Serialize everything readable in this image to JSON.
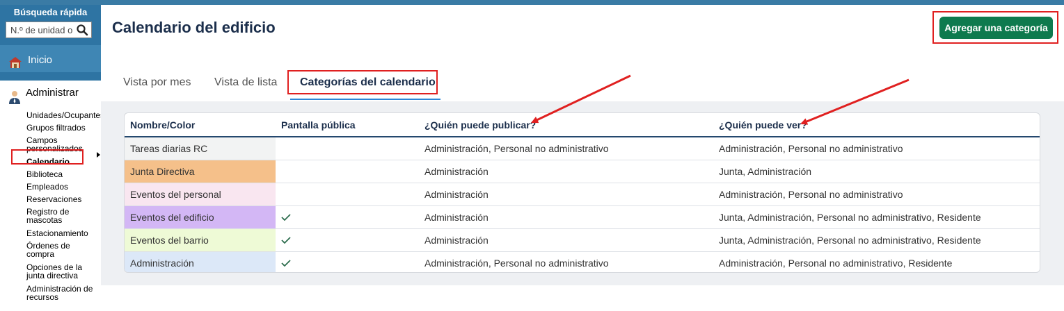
{
  "sidebar": {
    "quick_search": {
      "title": "Búsqueda rápida",
      "placeholder": "N.º de unidad o"
    },
    "home_label": "Inicio",
    "admin_label": "Administrar",
    "admin_items": [
      "Unidades/Ocupantes",
      "Grupos filtrados",
      "Campos personalizados",
      "Calendario",
      "Biblioteca",
      "Empleados",
      "Reservaciones",
      "Registro de mascotas",
      "Estacionamiento",
      "Órdenes de compra",
      "Opciones de la junta directiva",
      "Administración de recursos"
    ]
  },
  "page": {
    "title": "Calendario del edificio",
    "add_button": "Agregar una categoría",
    "tabs": [
      "Vista por mes",
      "Vista de lista",
      "Categorías del calendario"
    ]
  },
  "table": {
    "headers": [
      "Nombre/Color",
      "Pantalla pública",
      "¿Quién puede publicar?",
      "¿Quién puede ver?"
    ],
    "rows": [
      {
        "name": "Tareas diarias RC",
        "color": "#f2f3f3",
        "public": false,
        "post": "Administración, Personal no administrativo",
        "view": "Administración, Personal no administrativo"
      },
      {
        "name": "Junta Directiva",
        "color": "#f5c08a",
        "public": false,
        "post": "Administración",
        "view": "Junta, Administración"
      },
      {
        "name": "Eventos del personal",
        "color": "#f9e6f0",
        "public": false,
        "post": "Administración",
        "view": "Administración, Personal no administrativo"
      },
      {
        "name": "Eventos del edificio",
        "color": "#d3b7f5",
        "public": true,
        "post": "Administración",
        "view": "Junta, Administración, Personal no administrativo, Residente"
      },
      {
        "name": "Eventos del barrio",
        "color": "#eefad6",
        "public": true,
        "post": "Administración",
        "view": "Junta, Administración, Personal no administrativo, Residente"
      },
      {
        "name": "Administración",
        "color": "#dce8f8",
        "public": true,
        "post": "Administración, Personal no administrativo",
        "view": "Administración, Personal no administrativo, Residente"
      }
    ]
  },
  "colors": {
    "primary_button": "#0e7a4e",
    "sidebar_blue": "#2e74a3",
    "annotation_red": "#e02020",
    "tab_underline": "#2e86d6"
  },
  "icons": {
    "search": "search-icon",
    "home": "house-icon",
    "admin": "user-icon",
    "check": "check-icon",
    "caret": "caret-right-icon"
  }
}
